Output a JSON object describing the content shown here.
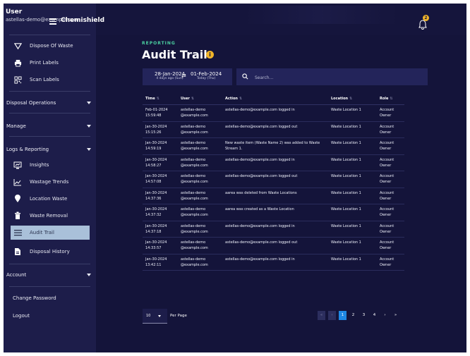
{
  "user": {
    "title": "User",
    "email": "astellas-demo@example.com"
  },
  "app": {
    "name": "Chemishield",
    "notification_count": "2"
  },
  "sidebar": {
    "top_items": [
      {
        "label": "Dispose Of Waste",
        "icon": "funnel-icon"
      },
      {
        "label": "Print Labels",
        "icon": "printer-icon"
      },
      {
        "label": "Scan Labels",
        "icon": "qr-code-icon"
      }
    ],
    "sections": {
      "disposal": "Disposal Operations",
      "manage": "Manage",
      "logs": "Logs & Reporting",
      "account": "Account"
    },
    "log_items": [
      {
        "label": "Insights",
        "icon": "insights-icon"
      },
      {
        "label": "Wastage Trends",
        "icon": "trend-icon"
      },
      {
        "label": "Location Waste",
        "icon": "location-pin-icon"
      },
      {
        "label": "Waste Removal",
        "icon": "trash-icon"
      },
      {
        "label": "Audit Trail",
        "icon": "list-icon"
      },
      {
        "label": "Disposal History",
        "icon": "document-icon"
      }
    ],
    "account_links": {
      "change_password": "Change Password",
      "logout": "Logout"
    }
  },
  "page": {
    "kicker": "REPORTING",
    "title": "Audit Trail"
  },
  "filters": {
    "date_from": "28-Jan-2024",
    "date_from_sub": "4 days ago (Sun)",
    "date_to": "01-Feb-2024",
    "date_to_sub": "Today (Thu)",
    "search_placeholder": "Search..."
  },
  "table": {
    "columns": [
      "Time",
      "User",
      "Action",
      "Location",
      "Role"
    ],
    "rows": [
      {
        "time": "Feb-01-2024\n15:59:48",
        "user": "astellas-demo\n@example.com",
        "action": "astellas-demo@example.com logged in",
        "location": "Waste Location 1",
        "role": "Account\nOwner"
      },
      {
        "time": "Jan-30-2024\n15:15:26",
        "user": "astellas-demo\n@example.com",
        "action": "astellas-demo@example.com logged out",
        "location": "Waste Location 1",
        "role": "Account\nOwner"
      },
      {
        "time": "Jan-30-2024\n14:59:19",
        "user": "astellas-demo\n@example.com",
        "action": "New waste item (Waste Name 2) was added to Waste Stream 1.",
        "location": "Waste Location 1",
        "role": "Account\nOwner"
      },
      {
        "time": "Jan-30-2024\n14:58:27",
        "user": "astellas-demo\n@example.com",
        "action": "astellas-demo@example.com logged in",
        "location": "Waste Location 1",
        "role": "Account\nOwner"
      },
      {
        "time": "Jan-30-2024\n14:57:08",
        "user": "astellas-demo\n@example.com",
        "action": "astellas-demo@example.com logged out",
        "location": "Waste Location 1",
        "role": "Account\nOwner"
      },
      {
        "time": "Jan-30-2024\n14:37:36",
        "user": "astellas-demo\n@example.com",
        "action": "aarea was deleted from Waste Locations",
        "location": "Waste Location 1",
        "role": "Account\nOwner"
      },
      {
        "time": "Jan-30-2024\n14:37:32",
        "user": "astellas-demo\n@example.com",
        "action": "aarea was created as a Waste Location",
        "location": "Waste Location 1",
        "role": "Account\nOwner"
      },
      {
        "time": "Jan-30-2024\n14:37:18",
        "user": "astellas-demo\n@example.com",
        "action": "astellas-demo@example.com logged in",
        "location": "Waste Location 1",
        "role": "Account\nOwner"
      },
      {
        "time": "Jan-30-2024\n14:33:57",
        "user": "astellas-demo\n@example.com",
        "action": "astellas-demo@example.com logged out",
        "location": "Waste Location 1",
        "role": "Account\nOwner"
      },
      {
        "time": "Jan-30-2024\n13:42:11",
        "user": "astellas-demo\n@example.com",
        "action": "astellas-demo@example.com logged in",
        "location": "Waste Location 1",
        "role": "Account\nOwner"
      }
    ]
  },
  "pagination": {
    "per_page_value": "10",
    "per_page_label": "Per Page",
    "first": "«",
    "prev": "‹",
    "pages": [
      "1",
      "2",
      "3",
      "4"
    ],
    "next": "›",
    "last": "»",
    "current": "1"
  },
  "colors": {
    "accent": "#1e88e5",
    "kicker": "#4bd0a0",
    "badge": "#f0b429",
    "active_nav": "#a9c0d9"
  }
}
